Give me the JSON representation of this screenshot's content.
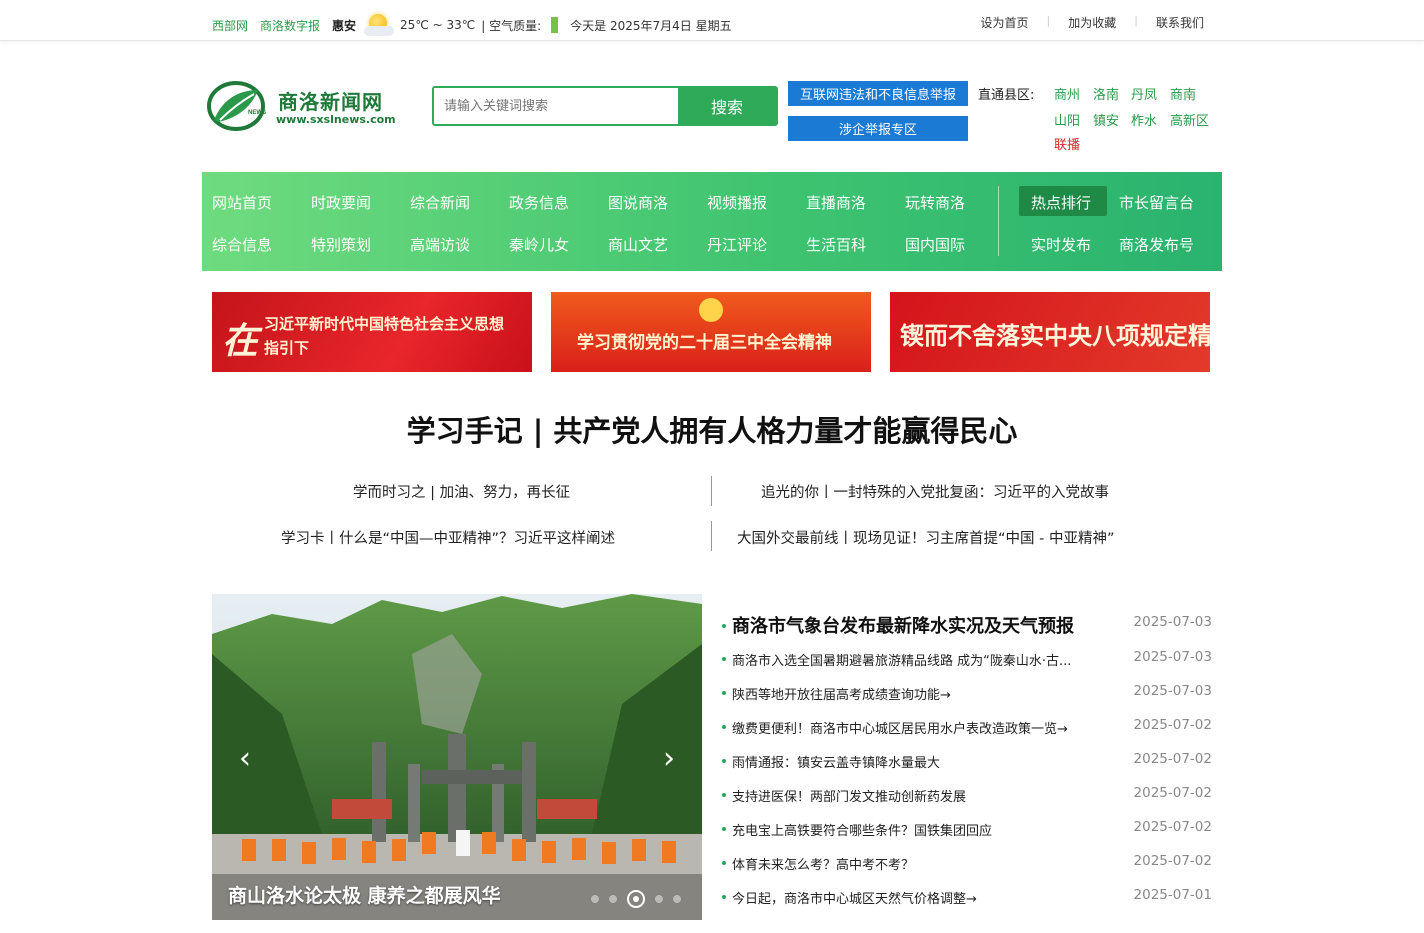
{
  "topbar": {
    "link1": "西部网",
    "link2": "商洛数字报",
    "city": "惠安",
    "temperature": "25℃ ~ 33℃",
    "air_quality_label": "| 空气质量:",
    "date_text": "今天是 2025年7月4日 星期五",
    "set_home": "设为首页",
    "add_fav": "加为收藏",
    "contact": "联系我们",
    "sep": "|"
  },
  "header": {
    "logo_name": "商洛新闻网",
    "logo_url": "www.sxslnews.com",
    "logo_news": "NEWS",
    "search_placeholder": "请输入关键词搜索",
    "search_button": "搜索",
    "report_button": "互联网违法和不良信息举报",
    "enterprise_button": "涉企举报专区",
    "county_label": "直通县区:",
    "counties": [
      "商州",
      "洛南",
      "丹凤",
      "商南",
      "山阳",
      "镇安",
      "柞水",
      "高新区"
    ],
    "liaobo": "联播"
  },
  "nav": {
    "row1": [
      "网站首页",
      "时政要闻",
      "综合新闻",
      "政务信息",
      "图说商洛",
      "视频播报",
      "直播商洛",
      "玩转商洛"
    ],
    "row2": [
      "综合信息",
      "特别策划",
      "高端访谈",
      "秦岭儿女",
      "商山文艺",
      "丹江评论",
      "生活百科",
      "国内国际"
    ],
    "right_row1": [
      "热点排行",
      "市长留言台"
    ],
    "right_row2": [
      "实时发布",
      "商洛发布号"
    ]
  },
  "banners": {
    "a_zai": "在",
    "a_line1": "习近平新时代中国特色社会主义思想",
    "a_line2": "指引下",
    "b_text": "学习贯彻党的二十届三中全会精神",
    "c_text": "锲而不舍落实中央八项规定精神"
  },
  "headline": {
    "title": "学习手记 | 共产党人拥有人格力量才能赢得民心",
    "sub1": "学而时习之 | 加油、努力，再长征",
    "sub2": "追光的你丨一封特殊的入党批复函：习近平的入党故事",
    "sub3": "学习卡丨什么是“中国—中亚精神”？习近平这样阐述",
    "sub4": "大国外交最前线丨现场见证！习主席首提“中国 - 中亚精神”"
  },
  "slideshow": {
    "caption": "商山洛水论太极 康养之都展风华",
    "prev": "‹",
    "next": "›",
    "dot_count": 5,
    "active_dot": 3
  },
  "news": [
    {
      "title": "商洛市气象台发布最新降水实况及天气预报",
      "date": "2025-07-03"
    },
    {
      "title": "商洛市入选全国暑期避暑旅游精品线路 成为“陇秦山水·古...",
      "date": "2025-07-03"
    },
    {
      "title": "陕西等地开放往届高考成绩查询功能→",
      "date": "2025-07-03"
    },
    {
      "title": "缴费更便利！商洛市中心城区居民用水户表改造政策一览→",
      "date": "2025-07-02"
    },
    {
      "title": "雨情通报：镇安云盖寺镇降水量最大",
      "date": "2025-07-02"
    },
    {
      "title": "支持进医保！两部门发文推动创新药发展",
      "date": "2025-07-02"
    },
    {
      "title": "充电宝上高铁要符合哪些条件？国铁集团回应",
      "date": "2025-07-02"
    },
    {
      "title": "体育未来怎么考？高中考不考？",
      "date": "2025-07-02"
    },
    {
      "title": "今日起，商洛市中心城区天然气价格调整→",
      "date": "2025-07-01"
    }
  ]
}
